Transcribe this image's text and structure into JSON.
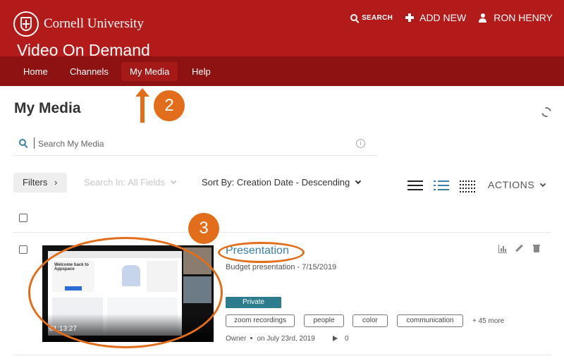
{
  "header": {
    "brand": "Cornell University",
    "site_title": "Video On Demand",
    "search_label": "SEARCH",
    "add_new_label": "ADD NEW",
    "user_name": "RON HENRY"
  },
  "nav": {
    "items": [
      {
        "label": "Home"
      },
      {
        "label": "Channels"
      },
      {
        "label": "My Media"
      },
      {
        "label": "Help"
      }
    ],
    "active": "My Media"
  },
  "page": {
    "title": "My Media"
  },
  "search": {
    "placeholder": "Search My Media"
  },
  "toolbar": {
    "filters_label": "Filters",
    "search_in_label": "Search In: All Fields",
    "sort_label": "Sort By: Creation Date - Descending",
    "actions_label": "ACTIONS"
  },
  "annotations": {
    "step_nav": "2",
    "step_item": "3"
  },
  "media": [
    {
      "title": "Presentation",
      "description": "Budget presentation - 7/15/2019",
      "duration": "01:13:27",
      "privacy": "Private",
      "tags": [
        "zoom recordings",
        "people",
        "color",
        "communication"
      ],
      "more_tags": "+ 45 more",
      "owner": "Owner",
      "date": "on July 23rd, 2019",
      "plays": "0",
      "thumbnail": {
        "card_title": "Welcome back to Appspace"
      }
    }
  ],
  "colors": {
    "header_red": "#b31b1b",
    "nav_red": "#8e1212",
    "link_blue": "#3a7fa8",
    "badge_teal": "#2d7c8e",
    "annotation_orange": "#e26e1b"
  }
}
